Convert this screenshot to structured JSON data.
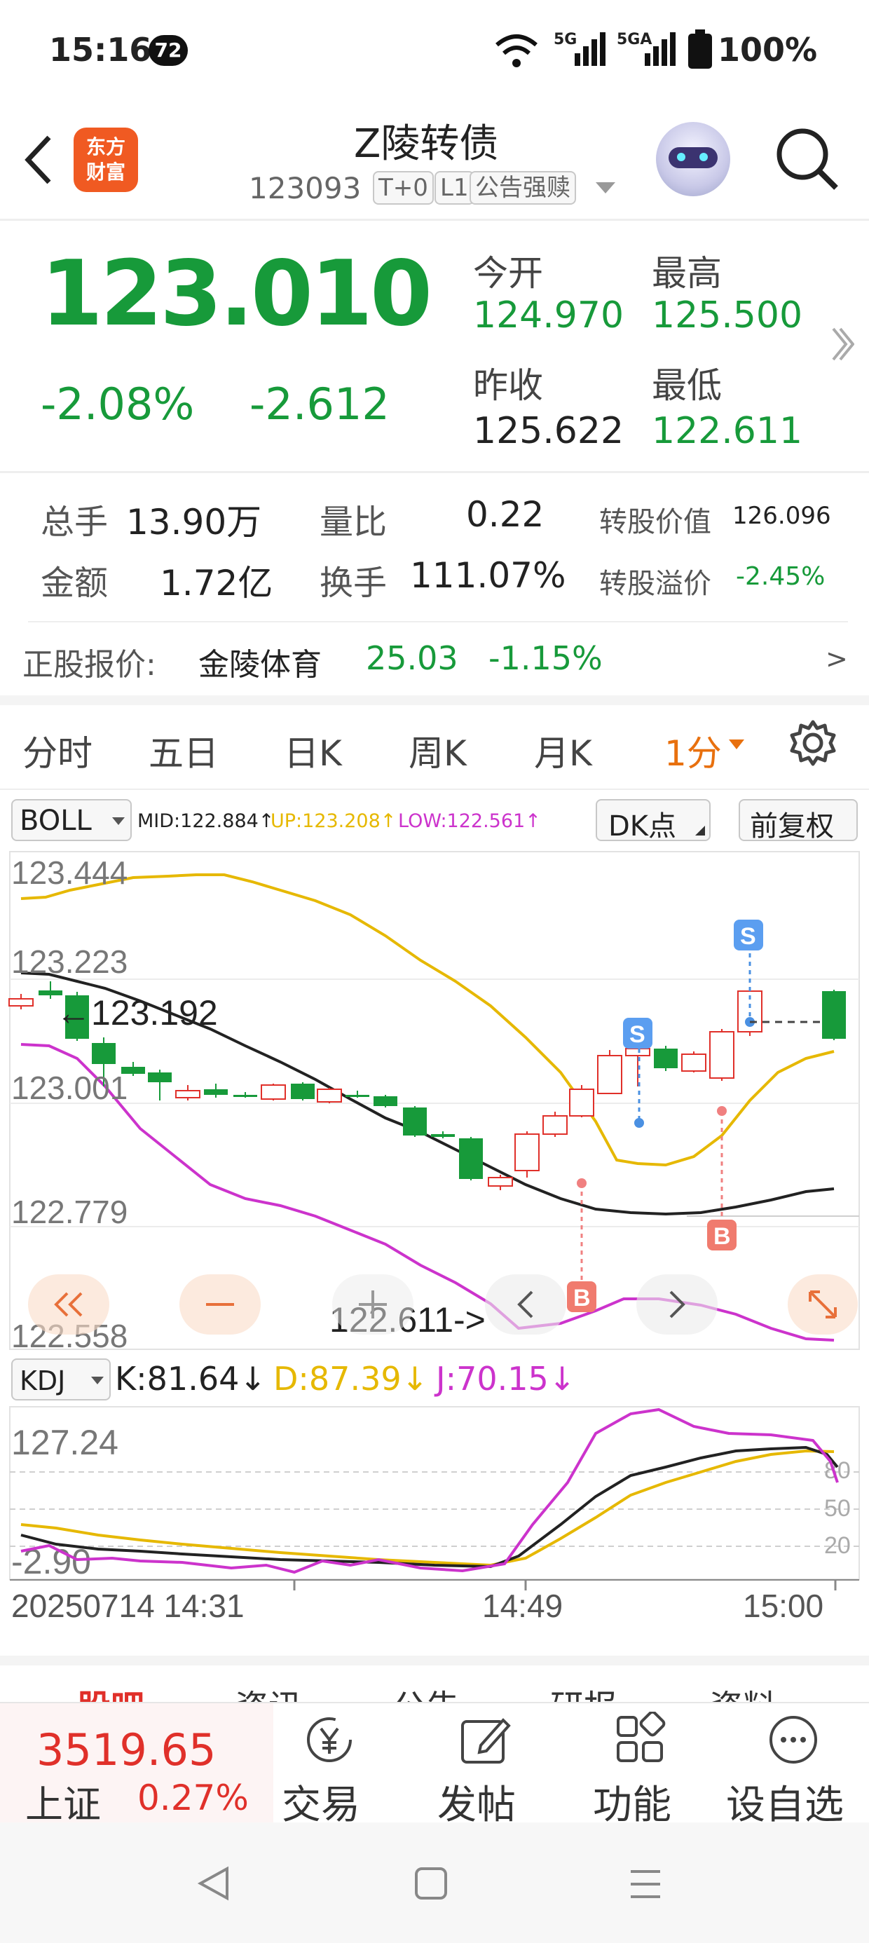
{
  "status_bar": {
    "time": "15:16",
    "notification_count": "72",
    "network1": "5G",
    "network2": "5GA",
    "battery": "100%"
  },
  "header": {
    "title": "Z陵转债",
    "code": "123093",
    "tags": [
      "T+0",
      "L1",
      "公告强赎"
    ],
    "logo_line1": "东方",
    "logo_line2": "财富"
  },
  "quote": {
    "price": "123.010",
    "change_pct": "-2.08%",
    "change": "-2.612",
    "open_label": "今开",
    "open": "124.970",
    "high_label": "最高",
    "high": "125.500",
    "prev_close_label": "昨收",
    "prev_close": "125.622",
    "low_label": "最低",
    "low": "122.611"
  },
  "stats": {
    "volume_label": "总手",
    "volume": "13.90万",
    "vol_ratio_label": "量比",
    "vol_ratio": "0.22",
    "conv_value_label": "转股价值",
    "conv_value": "126.096",
    "amount_label": "金额",
    "amount": "1.72亿",
    "turnover_label": "换手",
    "turnover": "111.07%",
    "conv_premium_label": "转股溢价",
    "conv_premium": "-2.45%"
  },
  "underlying": {
    "label": "正股报价:",
    "name": "金陵体育",
    "price": "25.03",
    "change": "-1.15%",
    "arrow": ">"
  },
  "tabs": [
    "分时",
    "五日",
    "日K",
    "周K",
    "月K",
    "1分"
  ],
  "boll": {
    "indicator": "BOLL",
    "mid": "MID:122.884↑",
    "up": "UP:123.208↑",
    "low": "LOW:122.561↑",
    "dk_label": "DK点",
    "adjust_label": "前复权",
    "y_labels": [
      "123.444",
      "123.223",
      "123.001",
      "122.779",
      "122.558"
    ],
    "high_marker": "←123.192",
    "low_marker": "122.611->",
    "signal_s": "S",
    "signal_b": "B"
  },
  "kdj": {
    "indicator": "KDJ",
    "k": "K:81.64↓",
    "d": "D:87.39↓",
    "j": "J:70.15↓",
    "y_top": "127.24",
    "y_bottom": "-2.90",
    "levels": [
      "80",
      "50",
      "20"
    ]
  },
  "time_axis": {
    "start": "20250714 14:31",
    "mid": "14:49",
    "end": "15:00"
  },
  "lower_tabs": [
    "股吧",
    "资讯",
    "公告",
    "研报",
    "资料"
  ],
  "bottom_nav": {
    "index_value": "3519.65",
    "index_name": "上证",
    "index_change": "0.27%",
    "items": [
      "交易",
      "发帖",
      "功能",
      "设自选"
    ]
  },
  "colors": {
    "up": "#e0302a",
    "down": "#179a3a",
    "mid_line": "#222222",
    "upper_band": "#e6b800",
    "lower_band": "#cc33cc",
    "accent": "#e8700e"
  }
}
